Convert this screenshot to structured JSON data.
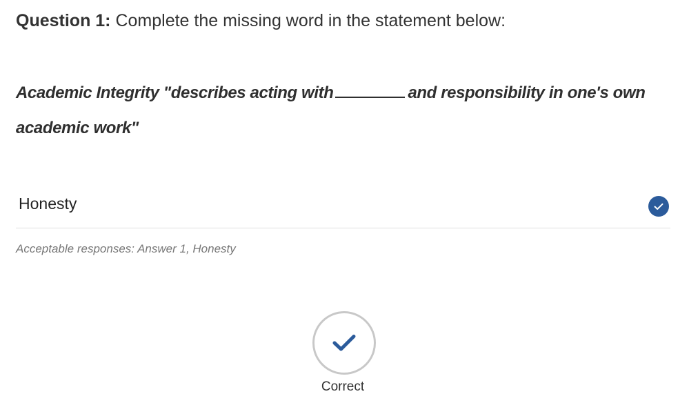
{
  "question": {
    "number_label": "Question 1:",
    "prompt": "Complete the missing word in the statement below:",
    "statement_before": "Academic Integrity \"describes acting with",
    "statement_after": "and responsibility in one's own academic work\""
  },
  "answer": {
    "value": "Honesty",
    "status_icon": "check-circle-icon",
    "status_color": "#2b5b9b"
  },
  "acceptable_responses": "Acceptable responses: Answer 1, Honesty",
  "result": {
    "icon": "checkmark-icon",
    "label": "Correct",
    "icon_color": "#2b5b9b"
  }
}
